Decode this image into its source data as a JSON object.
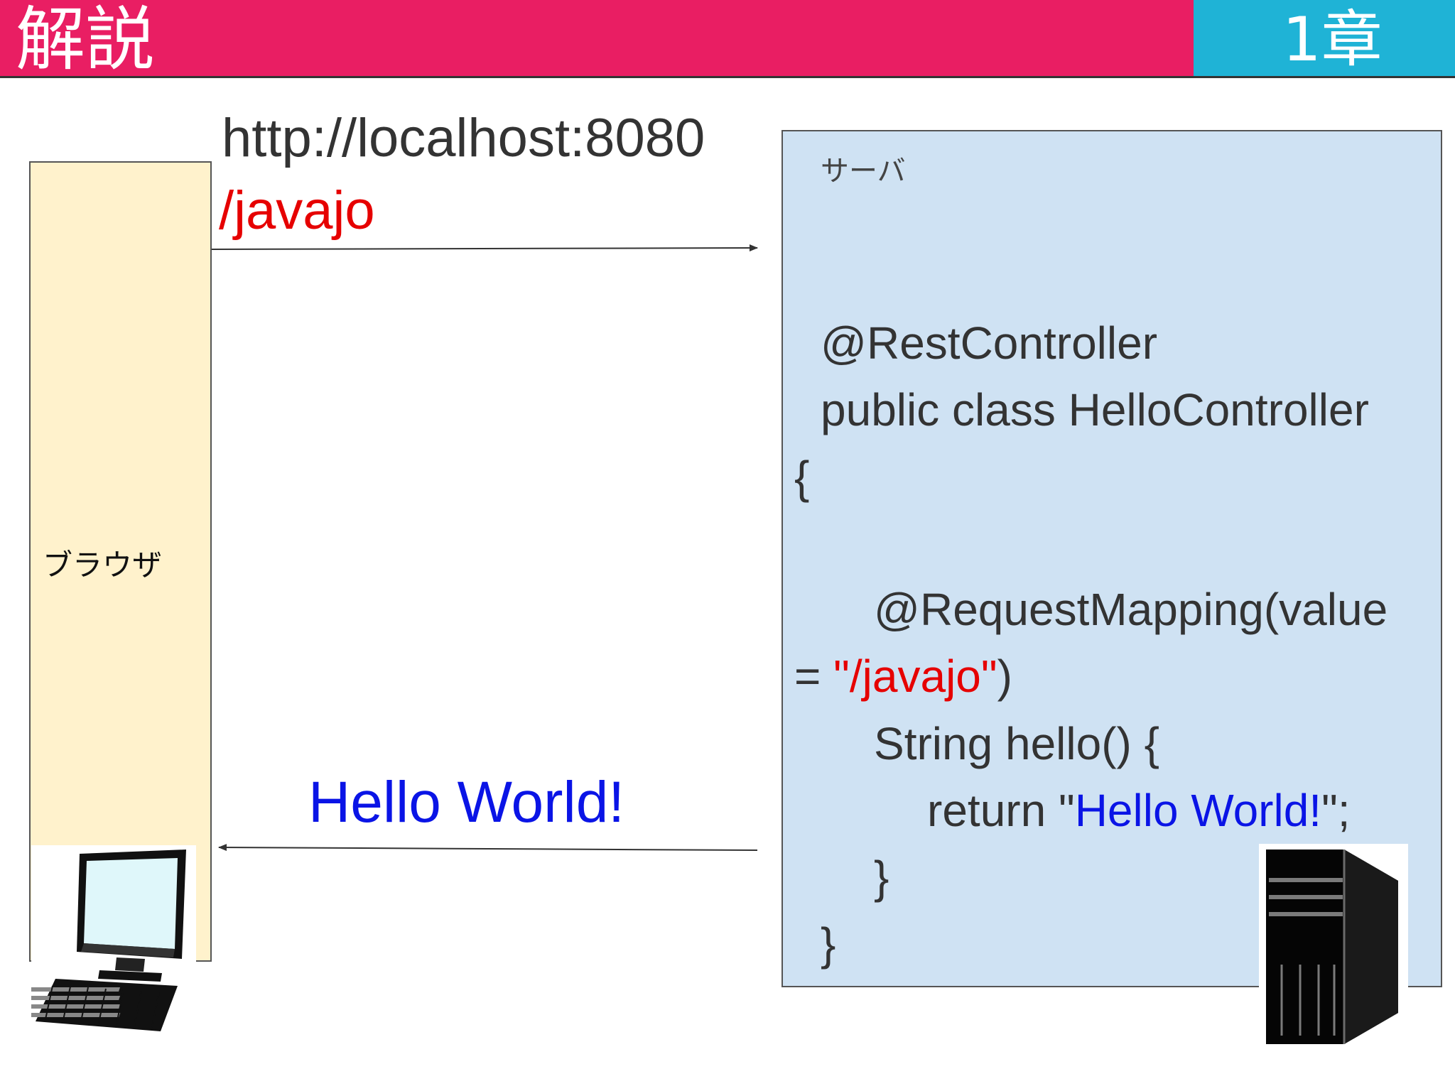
{
  "header": {
    "title": "解説",
    "chapter": "1章",
    "colors": {
      "title_bg": "#e91e63",
      "chapter_bg": "#1fb3d6"
    }
  },
  "browser": {
    "label": "ブラウザ",
    "icon": "desktop-computer-icon"
  },
  "server": {
    "label": "サーバ",
    "icon": "server-tower-icon"
  },
  "request": {
    "url_host": "http://localhost:8080",
    "url_path": "/javajo"
  },
  "response": {
    "text": "Hello World!"
  },
  "code": {
    "line1": "@RestController",
    "line2": "public class HelloController",
    "line3": "{",
    "line4": "@RequestMapping(value",
    "line5_prefix": "= ",
    "line5_string": "\"/javajo\"",
    "line5_suffix": ")",
    "line6": "String hello() {",
    "line7_prefix": "return \"",
    "line7_string": "Hello World!",
    "line7_suffix": "\";",
    "line8": "}",
    "line9": "}"
  }
}
